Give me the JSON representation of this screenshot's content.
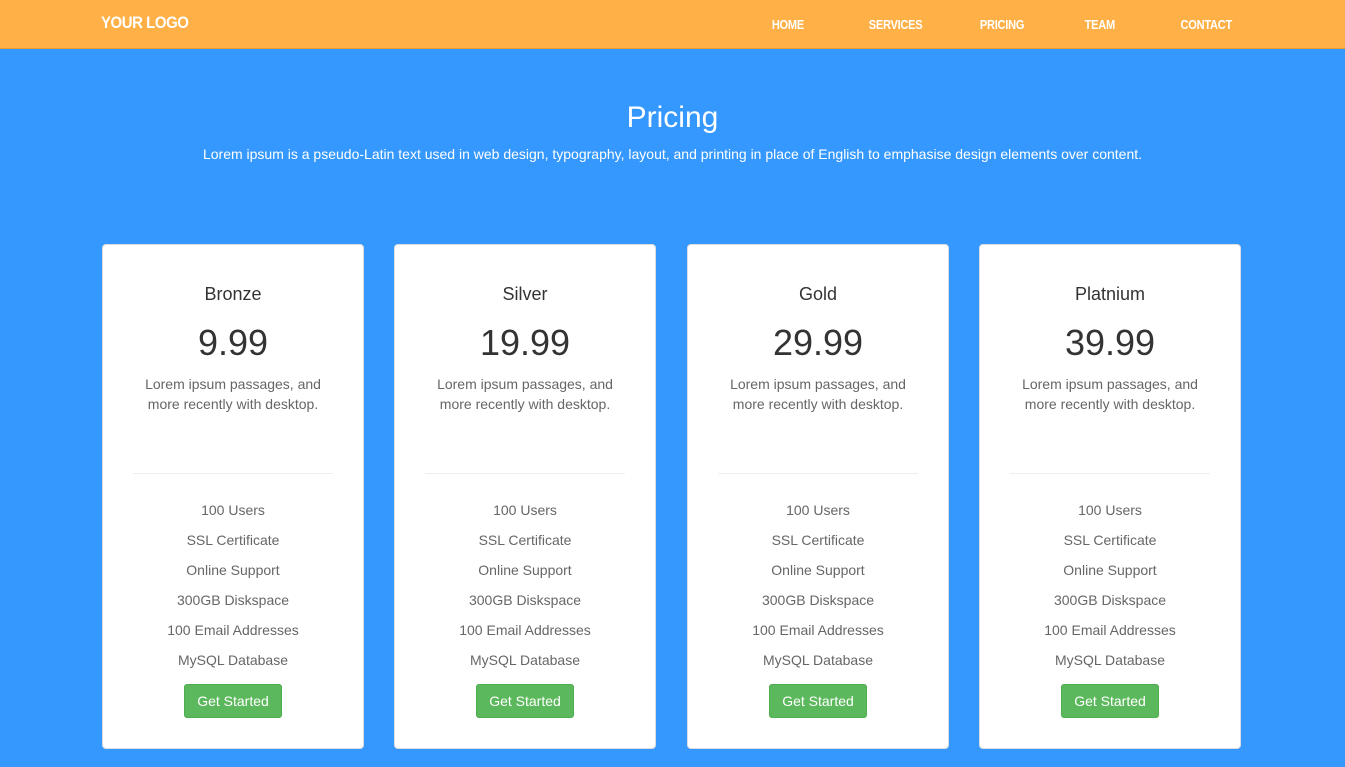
{
  "navbar": {
    "logo": "YOUR LOGO",
    "items": [
      "HOME",
      "SERVICES",
      "PRICING",
      "TEAM",
      "CONTACT"
    ]
  },
  "header": {
    "title": "Pricing",
    "subtitle": "Lorem ipsum is a pseudo-Latin text used in web design, typography, layout, and printing in place of English to emphasise design elements over content."
  },
  "plans": [
    {
      "name": "Bronze",
      "price": "9.99",
      "description": "Lorem ipsum passages, and more recently with desktop.",
      "features": [
        "100 Users",
        "SSL Certificate",
        "Online Support",
        "300GB Diskspace",
        "100 Email Addresses",
        "MySQL Database"
      ],
      "button_label": "Get Started"
    },
    {
      "name": "Silver",
      "price": "19.99",
      "description": "Lorem ipsum passages, and more recently with desktop.",
      "features": [
        "100 Users",
        "SSL Certificate",
        "Online Support",
        "300GB Diskspace",
        "100 Email Addresses",
        "MySQL Database"
      ],
      "button_label": "Get Started"
    },
    {
      "name": "Gold",
      "price": "29.99",
      "description": "Lorem ipsum passages, and more recently with desktop.",
      "features": [
        "100 Users",
        "SSL Certificate",
        "Online Support",
        "300GB Diskspace",
        "100 Email Addresses",
        "MySQL Database"
      ],
      "button_label": "Get Started"
    },
    {
      "name": "Platnium",
      "price": "39.99",
      "description": "Lorem ipsum passages, and more recently with desktop.",
      "features": [
        "100 Users",
        "SSL Certificate",
        "Online Support",
        "300GB Diskspace",
        "100 Email Addresses",
        "MySQL Database"
      ],
      "button_label": "Get Started"
    }
  ],
  "colors": {
    "navbar_bg": "#ffb047",
    "page_bg": "#3598fe",
    "button_bg": "#5cb85c"
  }
}
